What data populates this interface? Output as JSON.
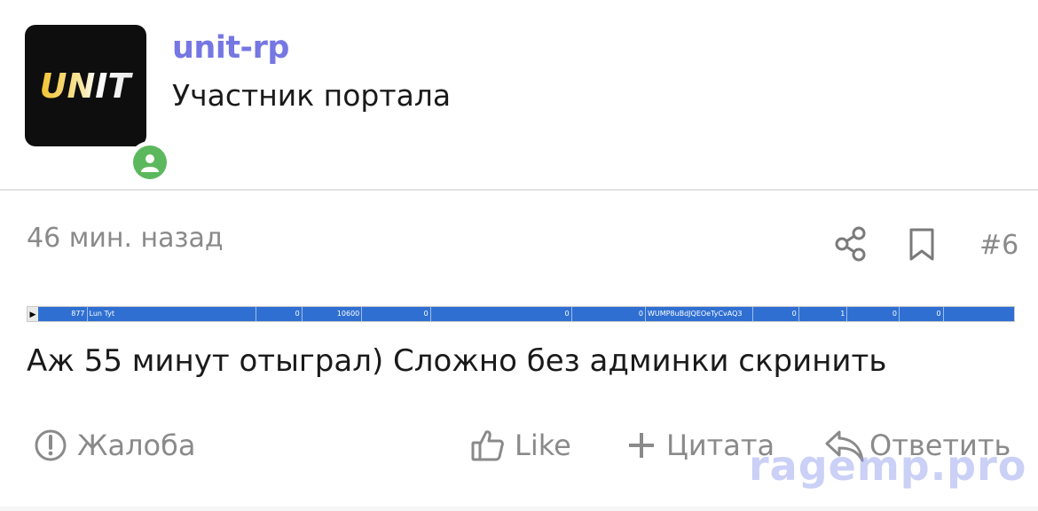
{
  "author": {
    "avatar_logo_text": "UNIT",
    "username": "unit-rp",
    "role": "Участник портала",
    "online_icon": "user-online-icon"
  },
  "post": {
    "timestamp": "46 мин. назад",
    "post_number": "#6",
    "share_icon": "share-icon",
    "bookmark_icon": "bookmark-icon",
    "embed_row": [
      "877",
      "Lun Tyt",
      "0",
      "10600",
      "0",
      "0",
      "0",
      "WUMP8uBdJQEOeTyCvAQ3",
      "0",
      "1",
      "0",
      "0"
    ],
    "text": "Аж 55 минут отыграл) Сложно без админки скринить"
  },
  "actions": {
    "report_label": "Жалоба",
    "like_label": "Like",
    "quote_label": "Цитата",
    "reply_label": "Ответить"
  },
  "watermark": "ragemp.pro",
  "colors": {
    "username": "#7577e3",
    "online": "#5cb85c",
    "muted": "#8a8a8a",
    "embed_bar": "#2f6fd1"
  }
}
